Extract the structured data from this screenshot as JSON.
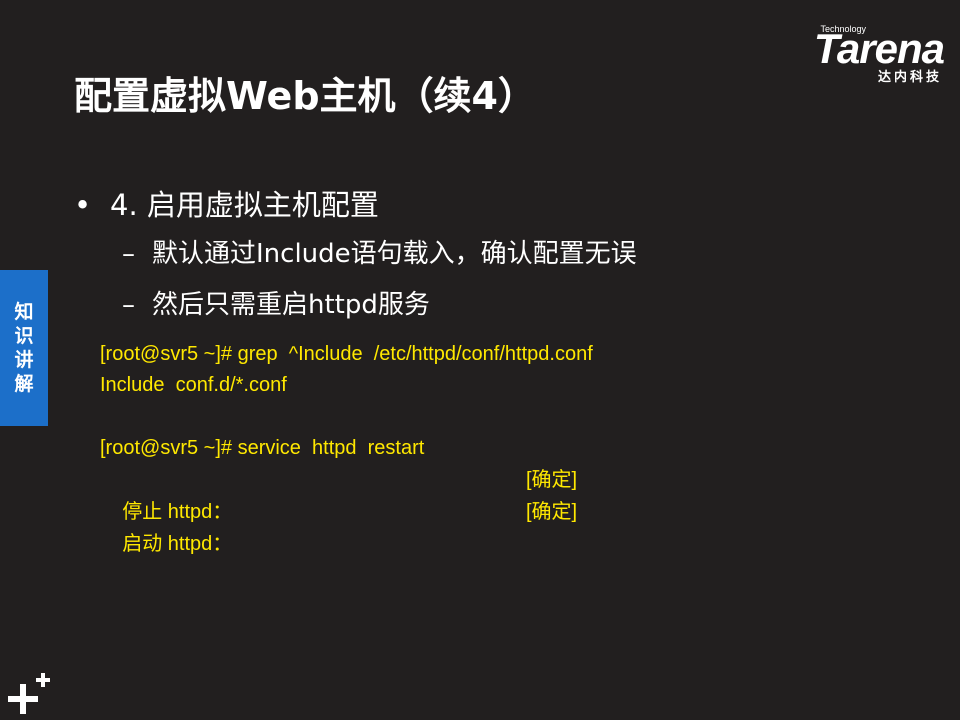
{
  "brand": {
    "tag": "Technology",
    "name": "Tarena",
    "cn": "达内科技"
  },
  "title": "配置虚拟Web主机（续4）",
  "side_tab": [
    "知",
    "识",
    "讲",
    "解"
  ],
  "bullet": {
    "marker": "•",
    "text": "4. 启用虚拟主机配置"
  },
  "sub_items": [
    {
      "marker": "–",
      "text": "默认通过Include语句载入，确认配置无误"
    },
    {
      "marker": "–",
      "text": "然后只需重启httpd服务"
    }
  ],
  "code": {
    "line1": "[root@svr5 ~]# grep  ^Include  /etc/httpd/conf/httpd.conf",
    "line2": "Include  conf.d/*.conf",
    "line3": "[root@svr5 ~]# service  httpd  restart",
    "line4": "停止 httpd：",
    "line4_status": "[确定]",
    "line5": "启动 httpd：",
    "line5_status": "[确定]"
  },
  "colors": {
    "background": "#221f1f",
    "code": "#ffe800",
    "tab": "#1c6fc9",
    "text": "#ffffff"
  },
  "icons": {
    "corner": "plus-plus-icon"
  }
}
